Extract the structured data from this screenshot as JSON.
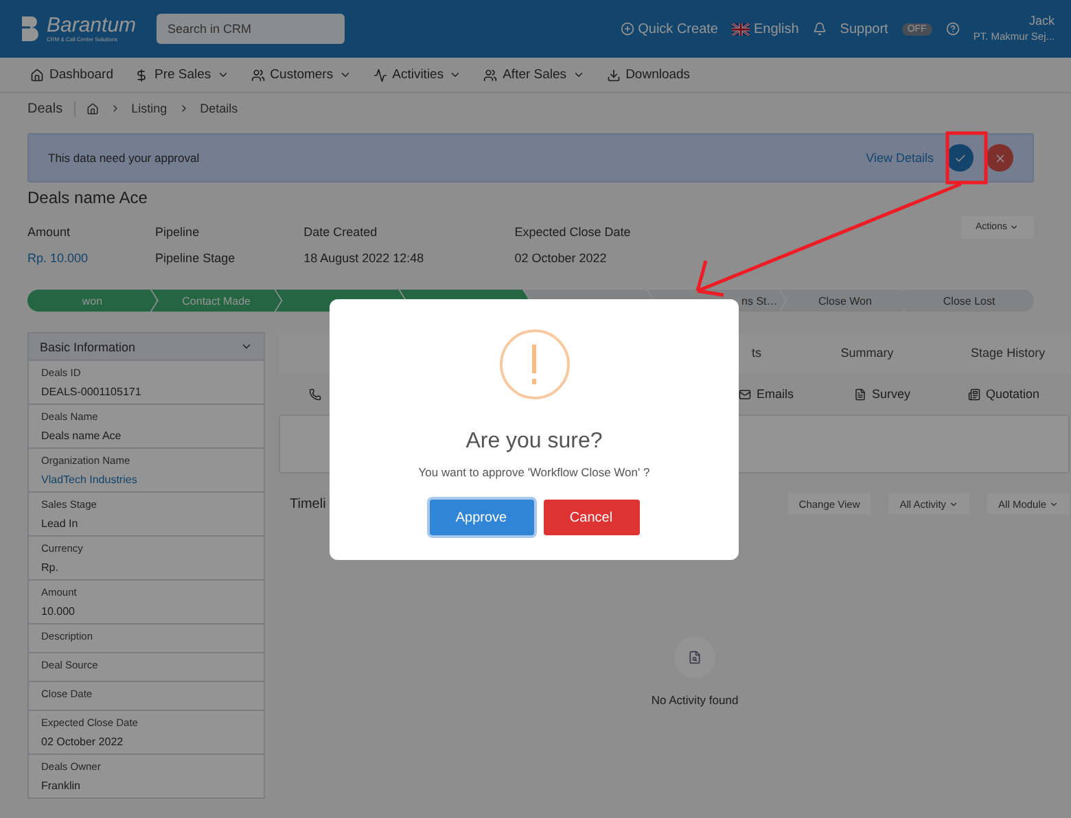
{
  "header": {
    "logo": {
      "name": "Barantum",
      "tagline": "CRM & Call Center Solutions"
    },
    "search": {
      "placeholder": "Search in CRM"
    },
    "quick_create": "Quick Create",
    "language": "English",
    "support": {
      "label": "Support",
      "toggle": "OFF",
      "on": false
    },
    "user": {
      "name": "Jack",
      "company": "PT. Makmur Sej..."
    }
  },
  "nav": [
    {
      "label": "Dashboard",
      "kind": "home",
      "dropdown": false
    },
    {
      "label": "Pre Sales",
      "kind": "dollar",
      "dropdown": true
    },
    {
      "label": "Customers",
      "kind": "users",
      "dropdown": true
    },
    {
      "label": "Activities",
      "kind": "pulse",
      "dropdown": true
    },
    {
      "label": "After Sales",
      "kind": "users",
      "dropdown": true
    },
    {
      "label": "Downloads",
      "kind": "download",
      "dropdown": false
    }
  ],
  "breadcrumb": {
    "title": "Deals",
    "items": [
      "Listing",
      "Details"
    ]
  },
  "approval": {
    "message": "This data need your approval",
    "link": "View Details"
  },
  "deal": {
    "title": "Deals name Ace",
    "actions": "Actions",
    "fields": [
      {
        "label": "Amount",
        "value": "Rp. 10.000",
        "kind": "link"
      },
      {
        "label": "Pipeline",
        "value": "Pipeline Stage",
        "kind": "text"
      },
      {
        "label": "Date Created",
        "value": "18 August 2022 12:48",
        "kind": "text"
      },
      {
        "label": "Expected Close Date",
        "value": "02 October 2022",
        "kind": "text"
      }
    ]
  },
  "stages": [
    {
      "label": "won",
      "done": true
    },
    {
      "label": "Contact Made",
      "done": true
    },
    {
      "done": true
    },
    {
      "done": true
    },
    {
      "done": false
    },
    {
      "label": "ns St…",
      "done": false,
      "cut": true
    },
    {
      "label": "Close Won",
      "done": false
    },
    {
      "label": "Close Lost",
      "done": false
    }
  ],
  "sidebar": {
    "title": "Basic Information",
    "fields": [
      {
        "label": "Deals ID",
        "value": "DEALS-0001105171",
        "kind": "text"
      },
      {
        "label": "Deals Name",
        "value": "Deals name Ace",
        "kind": "text"
      },
      {
        "label": "Organization Name",
        "value": "VladTech Industries",
        "kind": "link"
      },
      {
        "label": "Sales Stage",
        "value": "Lead In",
        "kind": "text"
      },
      {
        "label": "Currency",
        "value": "Rp.",
        "kind": "text"
      },
      {
        "label": "Amount",
        "value": "10.000",
        "kind": "text"
      },
      {
        "label": "Description"
      },
      {
        "label": "Deal Source"
      },
      {
        "label": "Close Date"
      },
      {
        "label": "Expected Close Date",
        "value": "02 October 2022",
        "kind": "text"
      },
      {
        "label": "Deals Owner",
        "value": "Franklin",
        "kind": "text"
      }
    ]
  },
  "tabs": [
    {
      "label": "ts"
    },
    {
      "label": "Summary"
    },
    {
      "label": "Stage History"
    }
  ],
  "activity_types": [
    {
      "label": "Emails",
      "kind": "mail"
    },
    {
      "label": "Survey",
      "kind": "file"
    },
    {
      "label": "Quotation",
      "kind": "quote"
    }
  ],
  "timeline": {
    "title": "Timeli",
    "buttons": [
      {
        "label": "Change View",
        "dropdown": false
      },
      {
        "label": "All Activity",
        "dropdown": true
      },
      {
        "label": "All Module",
        "dropdown": true
      }
    ],
    "empty": "No Activity found"
  },
  "modal": {
    "title": "Are you sure?",
    "message": "You want to approve 'Workflow Close Won' ?",
    "buttons": [
      {
        "label": "Approve",
        "kind": "confirm"
      },
      {
        "label": "Cancel",
        "kind": "cancel"
      }
    ]
  }
}
